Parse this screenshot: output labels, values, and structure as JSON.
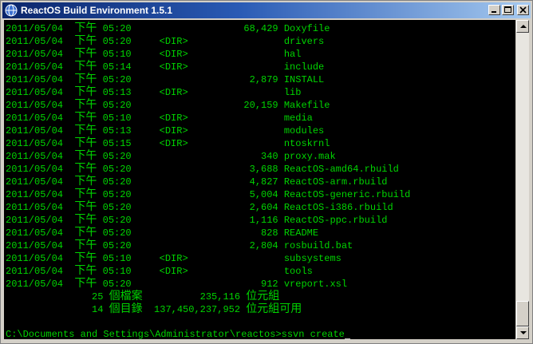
{
  "window": {
    "title": "ReactOS Build Environment 1.5.1",
    "icon": "reactos-globe-icon",
    "controls": [
      "minimize-icon",
      "maximize-icon",
      "close-icon"
    ]
  },
  "colors": {
    "console_bg": "#000000",
    "console_fg": "#00d400",
    "titlebar_start": "#0a246a",
    "titlebar_end": "#a6caf0"
  },
  "listing": [
    {
      "date": "2011/05/04",
      "ampm": "下午",
      "time": "05:20",
      "dir": "",
      "size": "68,429",
      "name": "Doxyfile"
    },
    {
      "date": "2011/05/04",
      "ampm": "下午",
      "time": "05:20",
      "dir": "<DIR>",
      "size": "",
      "name": "drivers"
    },
    {
      "date": "2011/05/04",
      "ampm": "下午",
      "time": "05:10",
      "dir": "<DIR>",
      "size": "",
      "name": "hal"
    },
    {
      "date": "2011/05/04",
      "ampm": "下午",
      "time": "05:14",
      "dir": "<DIR>",
      "size": "",
      "name": "include"
    },
    {
      "date": "2011/05/04",
      "ampm": "下午",
      "time": "05:20",
      "dir": "",
      "size": "2,879",
      "name": "INSTALL"
    },
    {
      "date": "2011/05/04",
      "ampm": "下午",
      "time": "05:13",
      "dir": "<DIR>",
      "size": "",
      "name": "lib"
    },
    {
      "date": "2011/05/04",
      "ampm": "下午",
      "time": "05:20",
      "dir": "",
      "size": "20,159",
      "name": "Makefile"
    },
    {
      "date": "2011/05/04",
      "ampm": "下午",
      "time": "05:10",
      "dir": "<DIR>",
      "size": "",
      "name": "media"
    },
    {
      "date": "2011/05/04",
      "ampm": "下午",
      "time": "05:13",
      "dir": "<DIR>",
      "size": "",
      "name": "modules"
    },
    {
      "date": "2011/05/04",
      "ampm": "下午",
      "time": "05:15",
      "dir": "<DIR>",
      "size": "",
      "name": "ntoskrnl"
    },
    {
      "date": "2011/05/04",
      "ampm": "下午",
      "time": "05:20",
      "dir": "",
      "size": "340",
      "name": "proxy.mak"
    },
    {
      "date": "2011/05/04",
      "ampm": "下午",
      "time": "05:20",
      "dir": "",
      "size": "3,688",
      "name": "ReactOS-amd64.rbuild"
    },
    {
      "date": "2011/05/04",
      "ampm": "下午",
      "time": "05:20",
      "dir": "",
      "size": "4,827",
      "name": "ReactOS-arm.rbuild"
    },
    {
      "date": "2011/05/04",
      "ampm": "下午",
      "time": "05:20",
      "dir": "",
      "size": "5,004",
      "name": "ReactOS-generic.rbuild"
    },
    {
      "date": "2011/05/04",
      "ampm": "下午",
      "time": "05:20",
      "dir": "",
      "size": "2,604",
      "name": "ReactOS-i386.rbuild"
    },
    {
      "date": "2011/05/04",
      "ampm": "下午",
      "time": "05:20",
      "dir": "",
      "size": "1,116",
      "name": "ReactOS-ppc.rbuild"
    },
    {
      "date": "2011/05/04",
      "ampm": "下午",
      "time": "05:20",
      "dir": "",
      "size": "828",
      "name": "README"
    },
    {
      "date": "2011/05/04",
      "ampm": "下午",
      "time": "05:20",
      "dir": "",
      "size": "2,804",
      "name": "rosbuild.bat"
    },
    {
      "date": "2011/05/04",
      "ampm": "下午",
      "time": "05:10",
      "dir": "<DIR>",
      "size": "",
      "name": "subsystems"
    },
    {
      "date": "2011/05/04",
      "ampm": "下午",
      "time": "05:10",
      "dir": "<DIR>",
      "size": "",
      "name": "tools"
    },
    {
      "date": "2011/05/04",
      "ampm": "下午",
      "time": "05:20",
      "dir": "",
      "size": "912",
      "name": "vreport.xsl"
    }
  ],
  "summary": {
    "files_count": "25",
    "files_label": "個檔案",
    "files_bytes": "235,116",
    "dirs_count": "14",
    "dirs_label": "個目錄",
    "free_bytes": "137,450,237,952",
    "bytes_label": "位元組",
    "free_label": "位元組可用"
  },
  "prompt": {
    "path": "C:\\Documents and Settings\\Administrator\\reactos>",
    "command": "ssvn create"
  }
}
